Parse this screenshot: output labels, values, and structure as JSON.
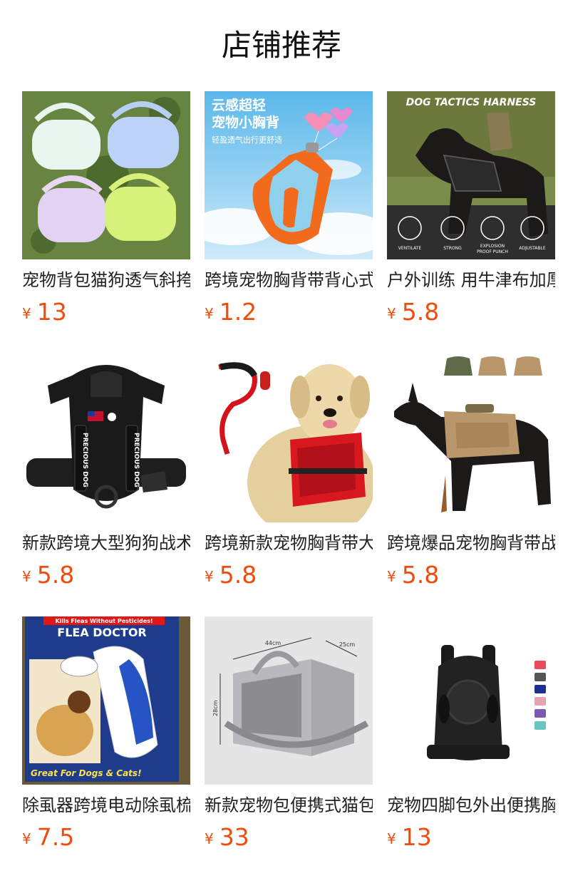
{
  "section": {
    "title": "店铺推荐"
  },
  "currency_symbol": "¥",
  "accent_color": "#ee4d0e",
  "products": [
    {
      "name": "宠物背包猫狗透气斜挎包",
      "price": "13",
      "image_icon": "pet-sling-bags-image"
    },
    {
      "name": "跨境宠物胸背带背心式",
      "price": "1.2",
      "image_icon": "orange-harness-image",
      "image_text": {
        "headline1": "云感超轻",
        "headline2": "宠物小胸背",
        "subline": "轻盈透气出行更舒适"
      }
    },
    {
      "name": "户外训练 用牛津布加厚",
      "price": "5.8",
      "image_icon": "doberman-tactical-harness-image",
      "image_text": {
        "banner": "DOG TACTICS HARNESS",
        "feature1": "VENTILATE",
        "feature2": "STRONG",
        "feature3a": "EXPLOSION",
        "feature3b": "PROOF PUNCH",
        "feature4": "ADJUSTABLE"
      }
    },
    {
      "name": "新款跨境大型狗狗战术胸背",
      "price": "5.8",
      "image_icon": "black-harness-image",
      "image_text": {
        "strap_label": "PRECIOUS DOG"
      }
    },
    {
      "name": "跨境新款宠物胸背带大型犬",
      "price": "5.8",
      "image_icon": "labrador-red-harness-image"
    },
    {
      "name": "跨境爆品宠物胸背带战术",
      "price": "5.8",
      "image_icon": "doberman-tan-harness-image"
    },
    {
      "name": "除虱器跨境电动除虱梳",
      "price": "7.5",
      "image_icon": "flea-comb-box-image",
      "image_text": {
        "top": "Kills Fleas Without Pesticides!",
        "brand": "FLEA DOCTOR",
        "bottom": "Great For Dogs & Cats!"
      }
    },
    {
      "name": "新款宠物包便携式猫包",
      "price": "33",
      "image_icon": "grey-carrier-bag-image",
      "image_text": {
        "dim1": "44cm",
        "dim2": "25cm",
        "dim3": "28cm"
      }
    },
    {
      "name": "宠物四脚包外出便携胸前包",
      "price": "13",
      "image_icon": "black-front-backpack-image"
    }
  ]
}
